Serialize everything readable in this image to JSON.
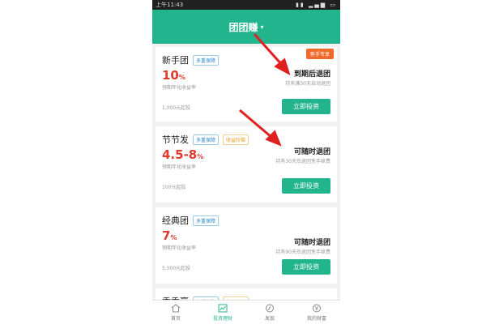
{
  "status": {
    "time": "上午11:43"
  },
  "header": {
    "title": "团团赚",
    "caret": "▾"
  },
  "cards": [
    {
      "name": "新手团",
      "tags": [
        "多重保障"
      ],
      "rate": "10",
      "rate_unit": "%",
      "rate_label": "预期年化收益率",
      "exit": "到期后退团",
      "exit_note": "持有满30天自动退团",
      "min": "1,000元起投",
      "button": "立即投资",
      "badge": "新手专享"
    },
    {
      "name": "节节发",
      "tags": [
        "多重保障",
        "收益阶梯"
      ],
      "rate": "4.5-8",
      "rate_unit": "%",
      "rate_label": "预期年化收益率",
      "exit": "可随时退团",
      "exit_note": "持有30天后退团免手续费",
      "min": "100元起投",
      "button": "立即投资"
    },
    {
      "name": "经典团",
      "tags": [
        "多重保障"
      ],
      "rate": "7",
      "rate_unit": "%",
      "rate_label": "预期年化收益率",
      "exit": "可随时退团",
      "exit_note": "持有90天后退团免手续费",
      "min": "5,000元起投",
      "button": "立即投资"
    },
    {
      "name": "季季赢",
      "tags": [
        "多重保障",
        "收益阶梯"
      ]
    }
  ],
  "tabbar": {
    "items": [
      "首页",
      "投资理财",
      "发现",
      "我的财富"
    ],
    "active_index": 1
  },
  "colors": {
    "accent": "#22b48c",
    "rate": "#e03a2a",
    "arrow": "#e02020"
  }
}
